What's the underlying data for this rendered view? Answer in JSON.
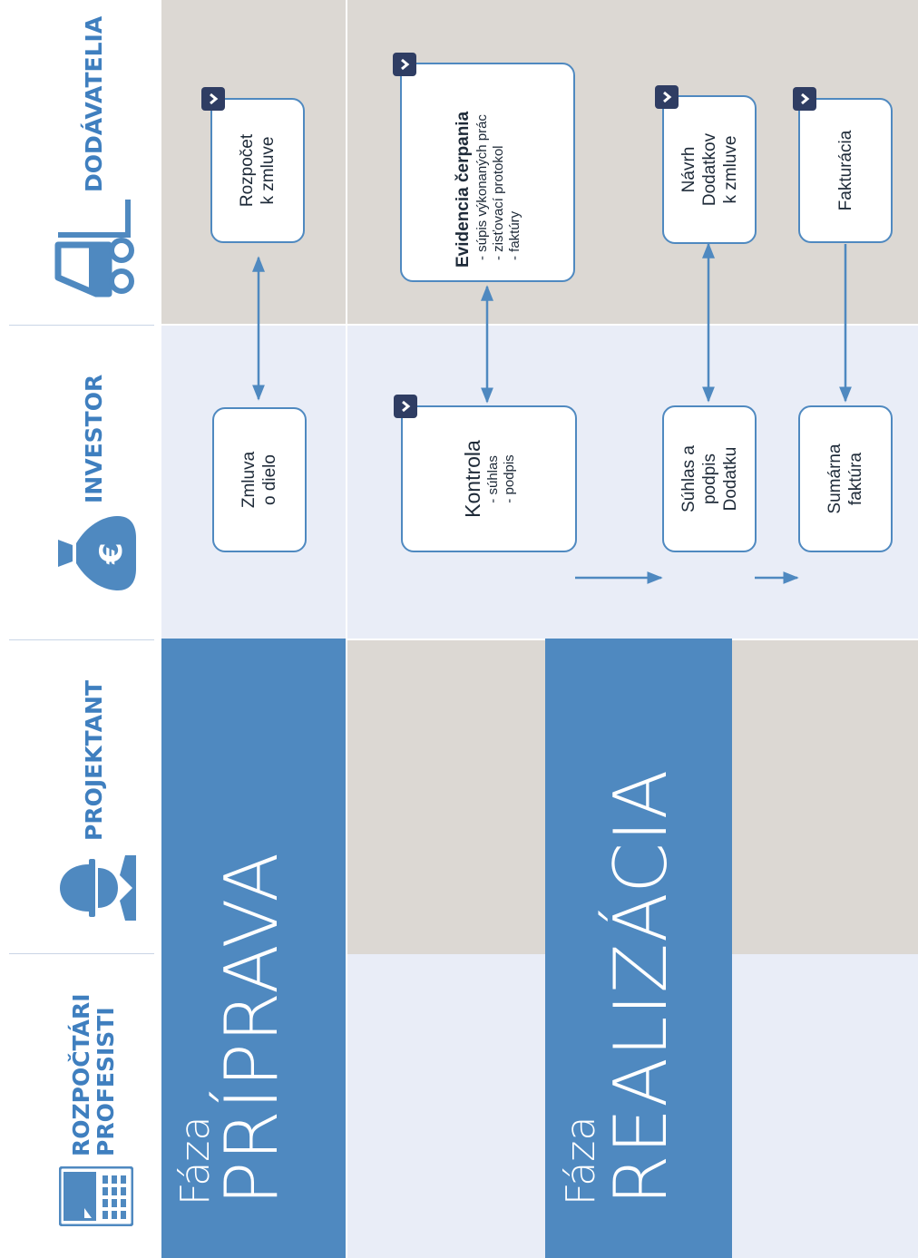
{
  "header": {
    "lanes": [
      {
        "label_line1": "ROZPOČTÁRI",
        "label_line2": "PROFESISTI",
        "icon": "calculator-icon"
      },
      {
        "label_line1": "PROJEKTANT",
        "label_line2": "",
        "icon": "engineer-icon"
      },
      {
        "label_line1": "INVESTOR",
        "label_line2": "",
        "icon": "money-bag-icon"
      },
      {
        "label_line1": "DODÁVATELIA",
        "label_line2": "",
        "icon": "forklift-icon"
      }
    ]
  },
  "phases": {
    "priprava": {
      "prefix": "Fáza",
      "title": "PRÍPRAVA"
    },
    "realizacia": {
      "prefix": "Fáza",
      "title": "REALIZÁCIA"
    }
  },
  "boxes": {
    "rozpocet": {
      "text": "Rozpočet\nk zmluve"
    },
    "zmluva": {
      "text": "Zmluva\no dielo"
    },
    "evidencia": {
      "title": "Evidencia čerpania",
      "sub": "- súpis výkonaných prác\n- zisťovací protokol\n- faktúry"
    },
    "kontrola": {
      "title": "Kontrola",
      "sub": "- súhlas\n- podpis"
    },
    "navrh": {
      "text": "Návrh\nDodatkov\nk zmluve"
    },
    "suhlas": {
      "text": "Súhlas a\npodpis\nDodatku"
    },
    "fakturacia": {
      "text": "Fakturácia"
    },
    "sumarna": {
      "text": "Sumárna\nfaktúra"
    }
  },
  "colors": {
    "accent": "#4f89c0",
    "lane_beige": "#dcd8d3",
    "lane_blue": "#e9edf7",
    "badge": "#2f3d63",
    "header_text": "#3f7fbf"
  }
}
